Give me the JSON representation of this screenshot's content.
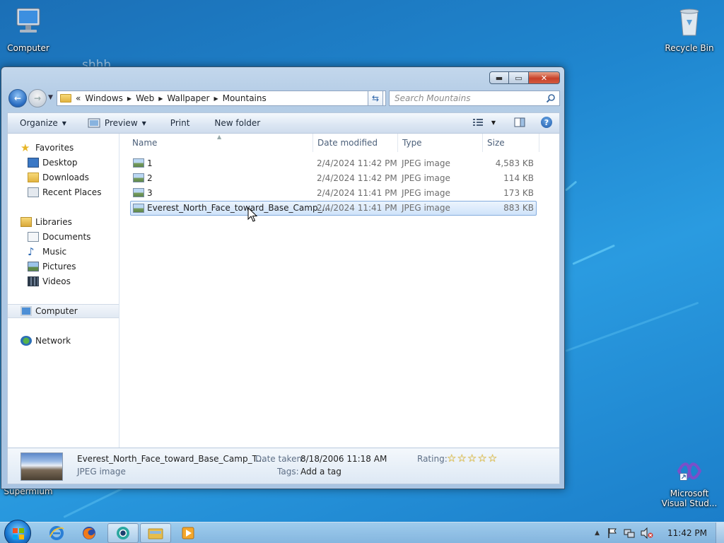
{
  "desktop": {
    "icons": {
      "computer": "Computer",
      "recycle_bin": "Recycle Bin",
      "supermium": "Supermium",
      "vs_line1": "Microsoft",
      "vs_line2": "Visual Stud..."
    },
    "ghost_text": "shhh"
  },
  "window": {
    "breadcrumbs": [
      "Windows",
      "Web",
      "Wallpaper",
      "Mountains"
    ],
    "overflow_marker": "«",
    "search_placeholder": "Search Mountains",
    "toolbar": {
      "organize": "Organize",
      "preview": "Preview",
      "print": "Print",
      "new_folder": "New folder"
    },
    "nav_pane": {
      "favorites": "Favorites",
      "desktop": "Desktop",
      "downloads": "Downloads",
      "recent_places": "Recent Places",
      "libraries": "Libraries",
      "documents": "Documents",
      "music": "Music",
      "pictures": "Pictures",
      "videos": "Videos",
      "computer": "Computer",
      "network": "Network"
    },
    "columns": {
      "name": "Name",
      "date_modified": "Date modified",
      "type": "Type",
      "size": "Size"
    },
    "files": [
      {
        "name": "1",
        "date": "2/4/2024 11:42 PM",
        "type": "JPEG image",
        "size": "4,583 KB"
      },
      {
        "name": "2",
        "date": "2/4/2024 11:42 PM",
        "type": "JPEG image",
        "size": "114 KB"
      },
      {
        "name": "3",
        "date": "2/4/2024 11:41 PM",
        "type": "JPEG image",
        "size": "173 KB"
      },
      {
        "name": "Everest_North_Face_toward_Base_Camp_...",
        "date": "2/4/2024 11:41 PM",
        "type": "JPEG image",
        "size": "883 KB"
      }
    ],
    "details": {
      "filename": "Everest_North_Face_toward_Base_Camp_T...",
      "filetype": "JPEG image",
      "date_taken_label": "Date taken:",
      "date_taken_value": "8/18/2006 11:18 AM",
      "tags_label": "Tags:",
      "tags_value": "Add a tag",
      "rating_label": "Rating:",
      "rating_stars": 0
    }
  },
  "taskbar": {
    "clock": "11:42 PM"
  },
  "colors": {
    "desktop_bg": "#1f86cf",
    "selection": "#cfe3fa",
    "close_button": "#c8412a"
  }
}
